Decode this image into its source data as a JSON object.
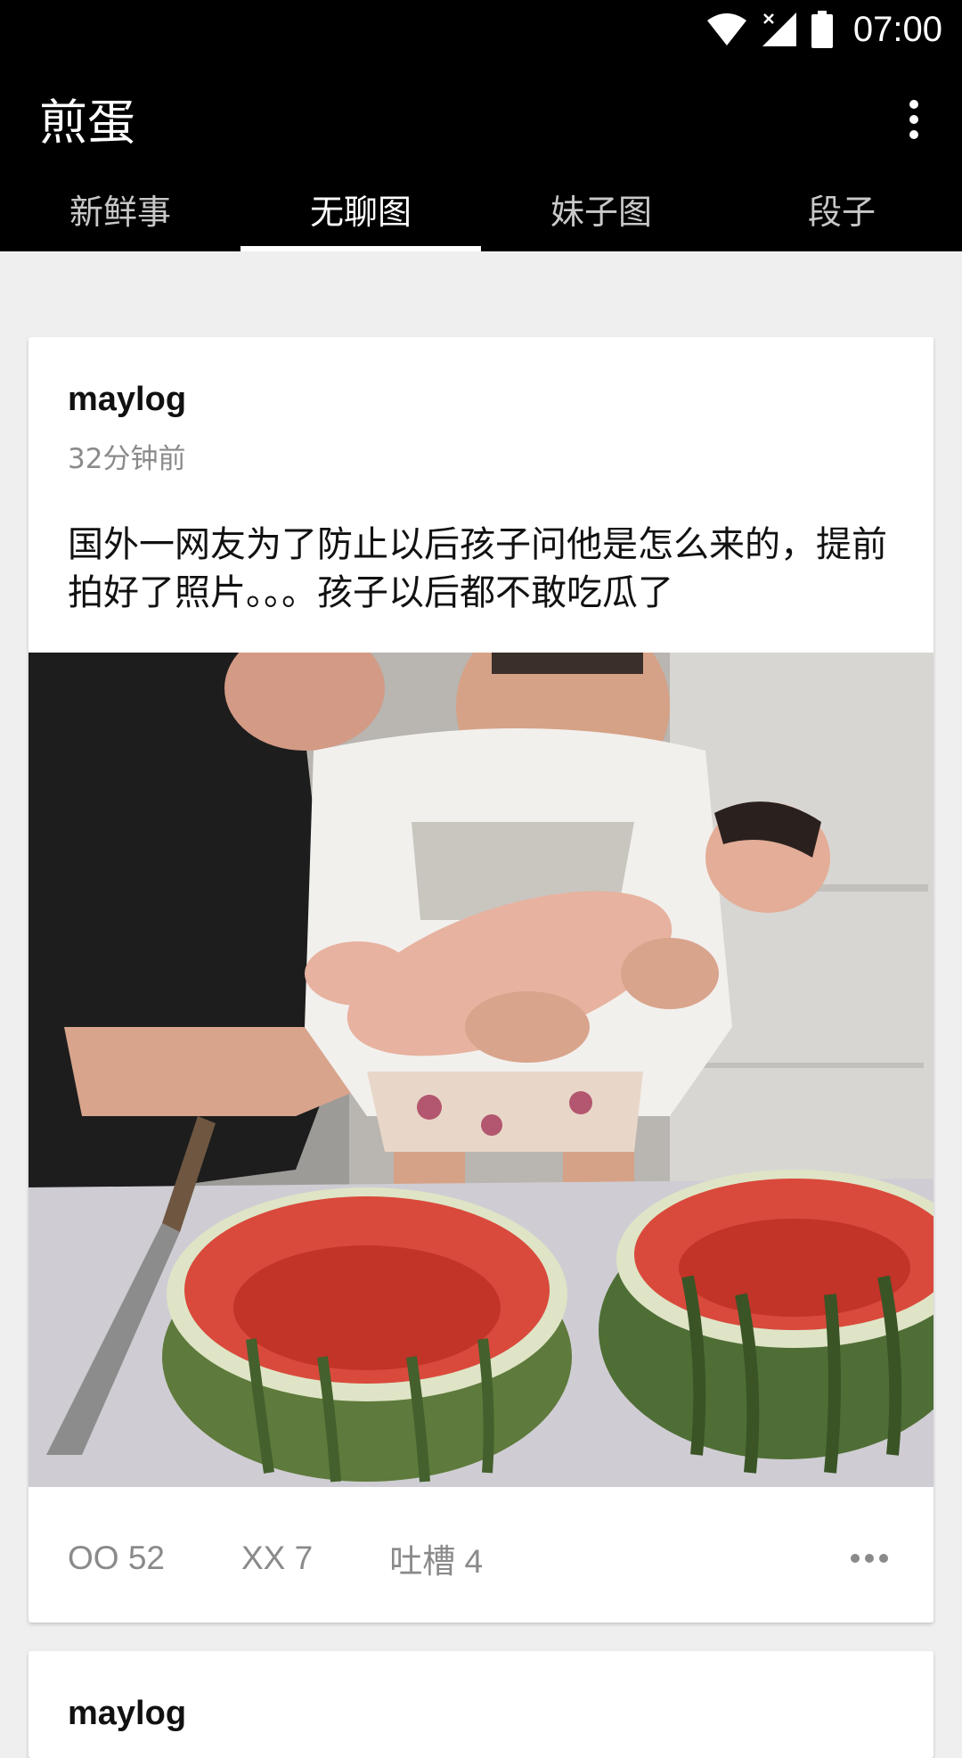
{
  "status_bar": {
    "time": "07:00",
    "icons": [
      "wifi-icon",
      "signal-no-data-icon",
      "battery-icon"
    ]
  },
  "app_bar": {
    "title": "煎蛋",
    "menu_icon": "more-vert-icon"
  },
  "tabs": [
    {
      "label": "新鲜事",
      "active": false
    },
    {
      "label": "无聊图",
      "active": true
    },
    {
      "label": "妹子图",
      "active": false
    },
    {
      "label": "段子",
      "active": false
    }
  ],
  "posts": [
    {
      "author": "maylog",
      "time": "32分钟前",
      "text": "国外一网友为了防止以后孩子问他是怎么来的，提前拍好了照片。。。孩子以后都不敢吃瓜了",
      "image": "photo: two adults holding a newborn baby over two hollowed watermelon halves with a knife on the table",
      "actions": {
        "oo": "OO 52",
        "xx": "XX 7",
        "comments": "吐槽 4",
        "more_icon": "more-horiz-icon"
      }
    },
    {
      "author": "maylog"
    }
  ],
  "colors": {
    "app_bar": "#000000",
    "background": "#efefef",
    "card": "#ffffff",
    "secondary_text": "#8a8a8a"
  }
}
